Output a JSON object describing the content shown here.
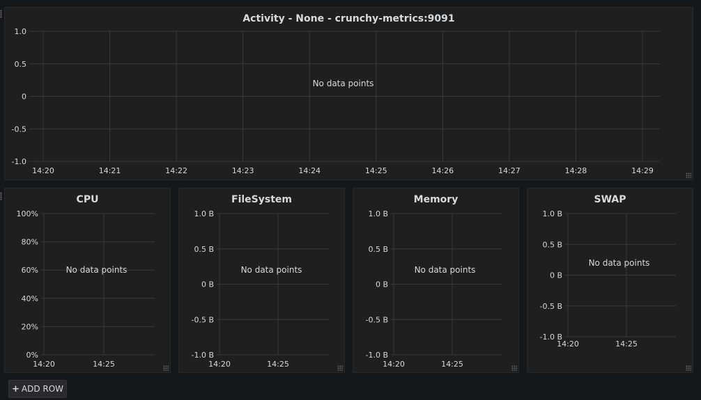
{
  "add_row": {
    "icon": "plus-icon",
    "label": "ADD ROW"
  },
  "panels": [
    {
      "id": "activity",
      "title": "Activity - None - crunchy-metrics:9091",
      "no_data": "No data points",
      "chart_data": {
        "type": "line",
        "title": "Activity - None - crunchy-metrics:9091",
        "x_ticks": [
          "14:20",
          "14:21",
          "14:22",
          "14:23",
          "14:24",
          "14:25",
          "14:26",
          "14:27",
          "14:28",
          "14:29"
        ],
        "y_ticks": [
          "1.0",
          "0.5",
          "0",
          "-0.5",
          "-1.0"
        ],
        "ylim": [
          -1.0,
          1.0
        ],
        "series": [],
        "grid": true
      }
    },
    {
      "id": "cpu",
      "title": "CPU",
      "no_data": "No data points",
      "chart_data": {
        "type": "line",
        "title": "CPU",
        "x_ticks": [
          "14:20",
          "14:25"
        ],
        "y_ticks": [
          "100%",
          "80%",
          "60%",
          "40%",
          "20%",
          "0%"
        ],
        "ylim": [
          0,
          100
        ],
        "series": [],
        "grid": true
      }
    },
    {
      "id": "filesystem",
      "title": "FileSystem",
      "no_data": "No data points",
      "chart_data": {
        "type": "line",
        "title": "FileSystem",
        "x_ticks": [
          "14:20",
          "14:25"
        ],
        "y_ticks": [
          "1.0 B",
          "0.5 B",
          "0 B",
          "-0.5 B",
          "-1.0 B"
        ],
        "ylim": [
          -1.0,
          1.0
        ],
        "series": [],
        "grid": true
      }
    },
    {
      "id": "memory",
      "title": "Memory",
      "no_data": "No data points",
      "chart_data": {
        "type": "line",
        "title": "Memory",
        "x_ticks": [
          "14:20",
          "14:25"
        ],
        "y_ticks": [
          "1.0 B",
          "0.5 B",
          "0 B",
          "-0.5 B",
          "-1.0 B"
        ],
        "ylim": [
          -1.0,
          1.0
        ],
        "series": [],
        "grid": true
      }
    },
    {
      "id": "swap",
      "title": "SWAP",
      "no_data": "No data points",
      "chart_data": {
        "type": "line",
        "title": "SWAP",
        "x_ticks": [
          "14:20",
          "14:25"
        ],
        "y_ticks": [
          "1.0 B",
          "0.5 B",
          "0 B",
          "-0.5 B",
          "-1.0 B"
        ],
        "ylim": [
          -1.0,
          1.0
        ],
        "series": [],
        "grid": true
      }
    }
  ]
}
